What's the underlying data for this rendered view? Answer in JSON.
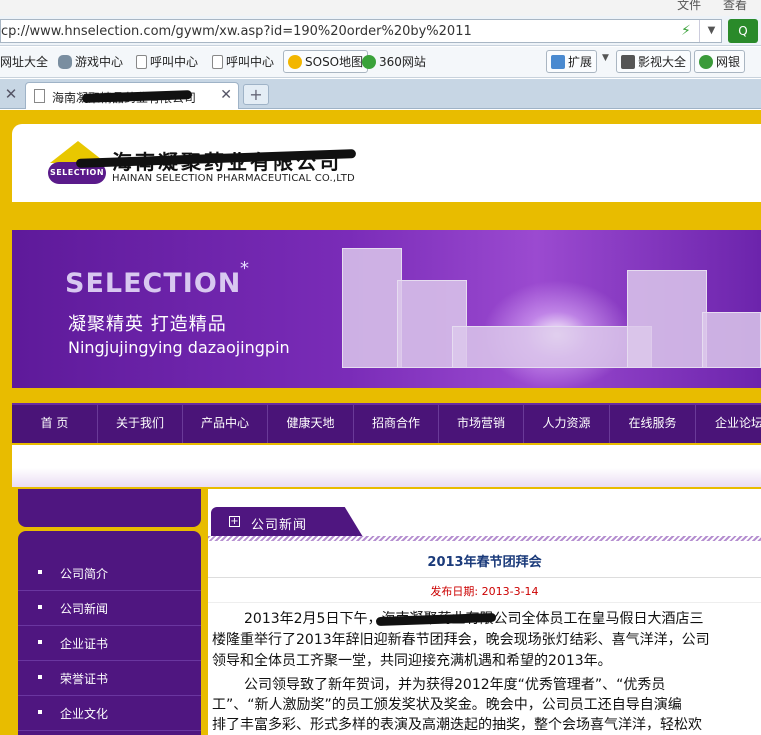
{
  "browser": {
    "menu": [
      "文件",
      "查看"
    ],
    "address_url": "cp://www.hnselection.com/gywm/xw.asp?id=190%20order%20by%2011",
    "go_label": "Q",
    "favorites": [
      "网址大全",
      "游戏中心",
      "呼叫中心",
      "呼叫中心",
      "SOSO地图",
      "360网站",
      "扩展",
      "影视大全",
      "网银"
    ],
    "tab_title": "海南凝聚精品药业有限公司",
    "new_tab": "+"
  },
  "header": {
    "logo_text": "SELECTION",
    "company_cn": "海南凝聚药业有限公司",
    "company_en": "HAINAN SELECTION PHARMACEUTICAL CO.,LTD"
  },
  "banner": {
    "title": "SELECTION",
    "star": "*",
    "slogan_cn": "凝聚精英 打造精品",
    "slogan_pinyin": "Ningjujingying dazaojingpin"
  },
  "nav": {
    "items": [
      "首 页",
      "关于我们",
      "产品中心",
      "健康天地",
      "招商合作",
      "市场营销",
      "人力资源",
      "在线服务",
      "企业论坛"
    ]
  },
  "sidebar": {
    "items": [
      "公司简介",
      "公司新闻",
      "企业证书",
      "荣誉证书",
      "企业文化"
    ]
  },
  "content": {
    "section_tab": "公司新闻",
    "article_title": "2013年春节团拜会",
    "pub_date": "发布日期: 2013-3-14",
    "paragraphs": [
      "2013年2月5日下午，海南凝聚药业有限公司全体员工在皇马假日大酒店三",
      "楼隆重举行了2013年辞旧迎新春节团拜会，晚会现场张灯结彩、喜气洋洋，公司",
      "领导和全体员工齐聚一堂，共同迎接充满机遇和希望的2013年。",
      "公司领导致了新年贺词，并为获得2012年度“优秀管理者”、“优秀员",
      "工”、“新人激励奖”的员工颁发奖状及奖金。晚会中，公司员工还自导自演编",
      "排了丰富多彩、形式多样的表演及高潮迭起的抽奖，整个会场喜气洋洋，轻松欢"
    ]
  }
}
